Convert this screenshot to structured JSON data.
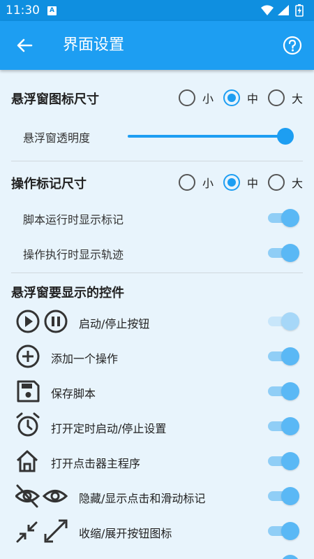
{
  "status": {
    "time": "11:30",
    "notification_letter": "A"
  },
  "appbar": {
    "title": "界面设置"
  },
  "floating_icon_size": {
    "title": "悬浮窗图标尺寸",
    "options": [
      "小",
      "中",
      "大"
    ],
    "selected": "中",
    "transparency_label": "悬浮窗透明度",
    "transparency_value": 1.0
  },
  "marker_size": {
    "title": "操作标记尺寸",
    "options": [
      "小",
      "中",
      "大"
    ],
    "selected": "中",
    "show_marker_label": "脚本运行时显示标记",
    "show_trace_label": "操作执行时显示轨迹"
  },
  "controls": {
    "title": "悬浮窗要显示的控件",
    "items": [
      {
        "label": "启动/停止按钮",
        "icons": [
          "play-icon",
          "pause-icon"
        ],
        "enabled": false
      },
      {
        "label": "添加一个操作",
        "icons": [
          "add-icon"
        ],
        "enabled": true
      },
      {
        "label": "保存脚本",
        "icons": [
          "save-icon"
        ],
        "enabled": true
      },
      {
        "label": "打开定时启动/停止设置",
        "icons": [
          "alarm-icon"
        ],
        "enabled": true
      },
      {
        "label": "打开点击器主程序",
        "icons": [
          "home-icon"
        ],
        "enabled": true
      },
      {
        "label": "隐藏/显示点击和滑动标记",
        "icons": [
          "eye-off-icon",
          "eye-icon"
        ],
        "enabled": true
      },
      {
        "label": "收缩/展开按钮图标",
        "icons": [
          "collapse-icon",
          "expand-icon"
        ],
        "enabled": true
      }
    ]
  },
  "colors": {
    "accent": "#1d9ef2",
    "statusbar": "#0f8fe0",
    "background": "#e8f4fc"
  }
}
